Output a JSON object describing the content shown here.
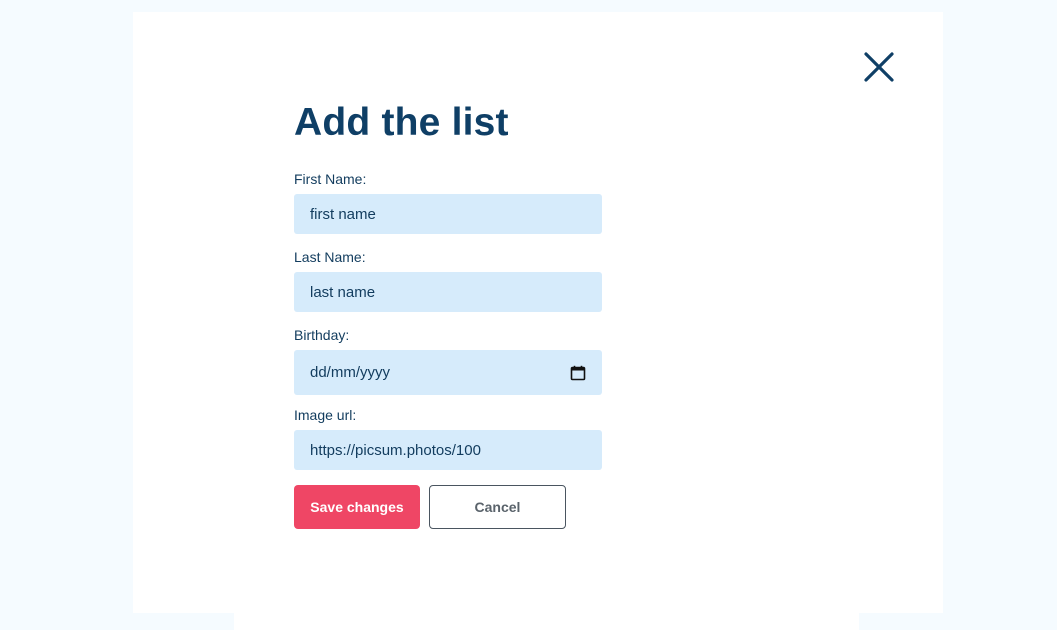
{
  "modal": {
    "title": "Add the list",
    "close_icon": "close-icon",
    "fields": {
      "first_name": {
        "label": "First Name:",
        "placeholder": "first name"
      },
      "last_name": {
        "label": "Last Name:",
        "placeholder": "last name"
      },
      "birthday": {
        "label": "Birthday:",
        "placeholder": "dd/mm/yyyy",
        "icon": "calendar-icon"
      },
      "image_url": {
        "label": "Image url:",
        "value": "https://picsum.photos/100"
      }
    },
    "buttons": {
      "save": "Save changes",
      "cancel": "Cancel"
    }
  },
  "colors": {
    "page_background": "#f5fbff",
    "heading": "#0f3f66",
    "input_background": "#d6ebfb",
    "primary_button": "#ef4665",
    "cancel_border": "#4a5560"
  }
}
